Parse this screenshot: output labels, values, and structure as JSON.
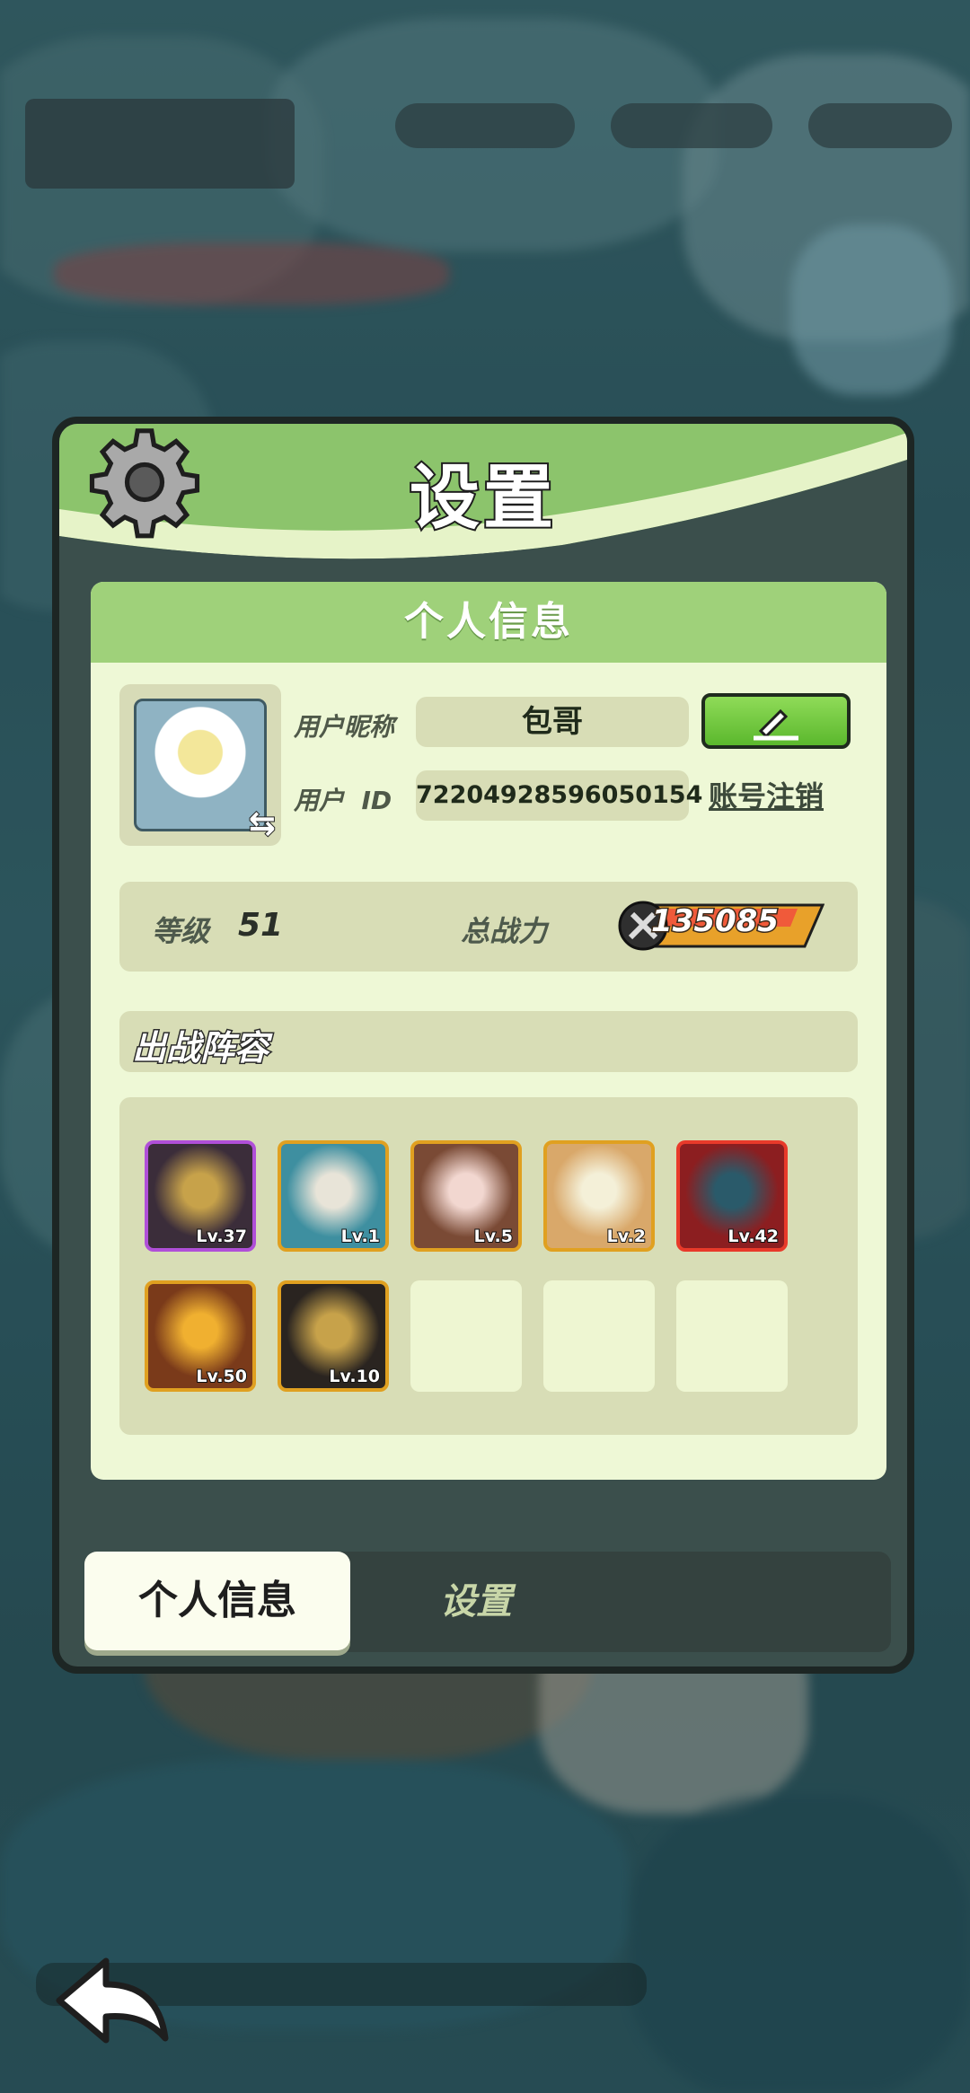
{
  "dialog": {
    "title": "设置",
    "panel_title": "个人信息"
  },
  "profile": {
    "nickname_label": "用户昵称",
    "nickname": "包哥",
    "id_label": "用户  ID",
    "user_id": "72204928596050154",
    "deregister_link": "账号注销",
    "level_label": "等级",
    "level": "51",
    "power_label": "总战力",
    "power": "135085"
  },
  "team": {
    "title": "出战阵容",
    "heroes": [
      {
        "level": "Lv.37",
        "frame": "#b04fd8",
        "bg": "#3b2d3a",
        "accent": "#c7a24a"
      },
      {
        "level": "Lv.1",
        "frame": "#e0a020",
        "bg": "#3e8fa0",
        "accent": "#e8e4d8"
      },
      {
        "level": "Lv.5",
        "frame": "#e0a020",
        "bg": "#7a4a35",
        "accent": "#f2d7d0"
      },
      {
        "level": "Lv.2",
        "frame": "#e0a020",
        "bg": "#d9a86a",
        "accent": "#f4f0d8"
      },
      {
        "level": "Lv.42",
        "frame": "#e83a2a",
        "bg": "#8c1e20",
        "accent": "#2a5a6a"
      },
      {
        "level": "Lv.50",
        "frame": "#e0a020",
        "bg": "#7a3a1a",
        "accent": "#f0b030"
      },
      {
        "level": "Lv.10",
        "frame": "#e0a020",
        "bg": "#2a2420",
        "accent": "#c7a24a"
      }
    ],
    "empty_slots": 3
  },
  "tabs": {
    "active": "个人信息",
    "other": "设置"
  },
  "colors": {
    "header_green": "#8cc46c",
    "panel_bg": "#eef8d6",
    "edit_button": "#6cc43a"
  }
}
